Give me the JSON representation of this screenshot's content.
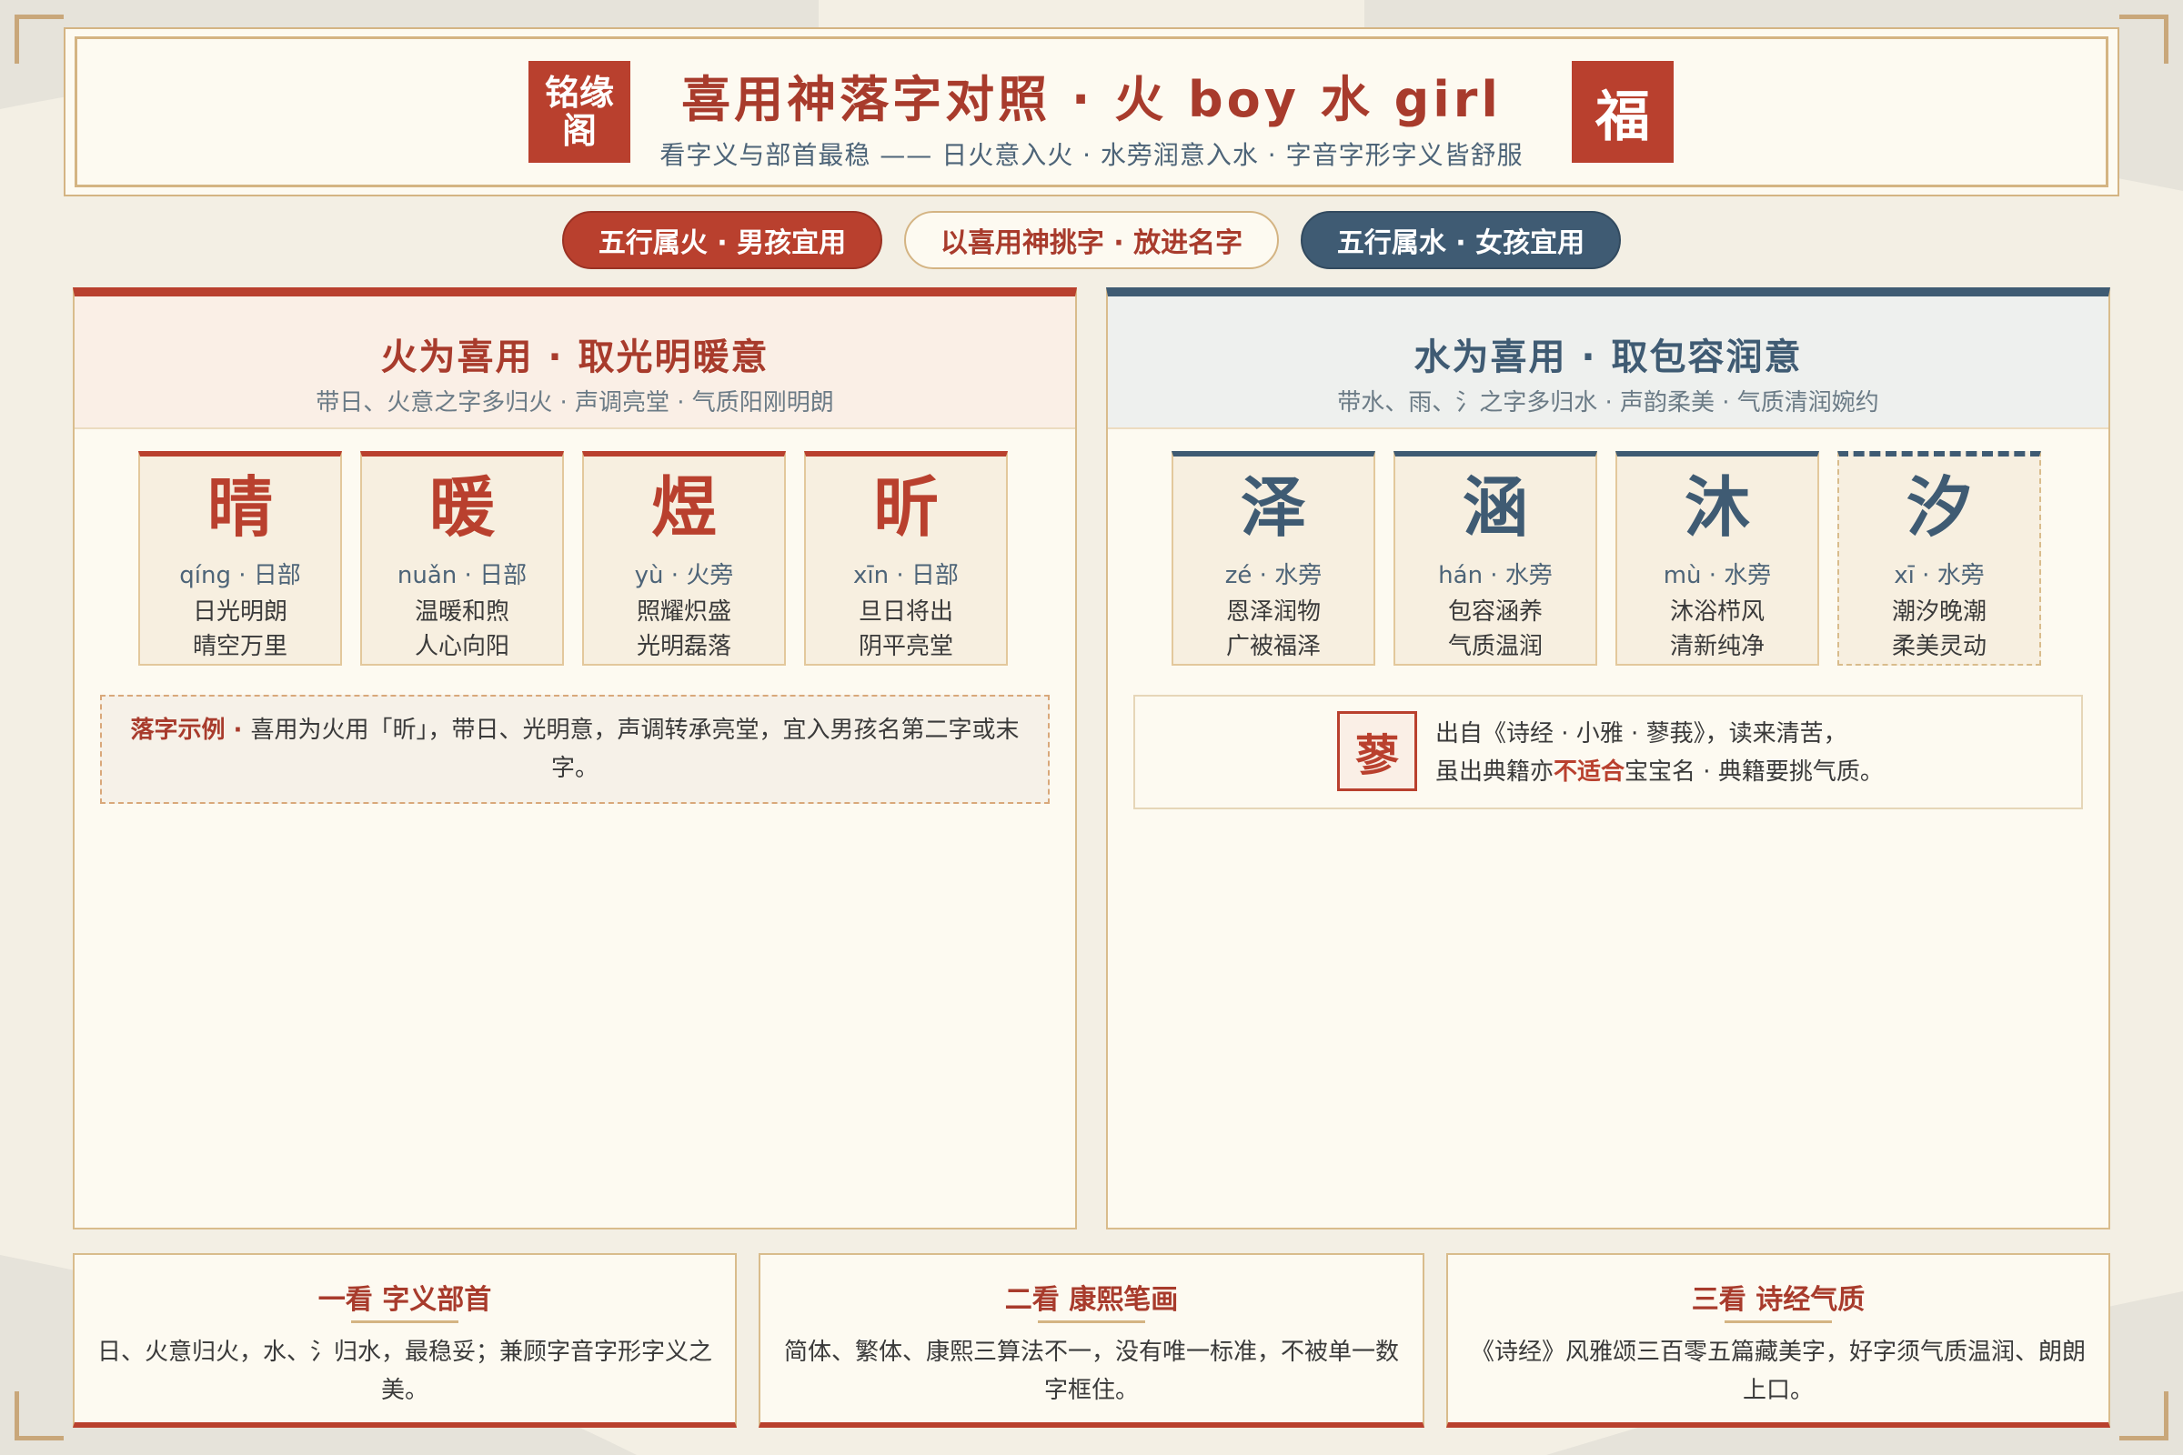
{
  "header": {
    "seal_left": "铭缘阁",
    "title": "喜用神落字对照 · 火 boy 水 girl",
    "subtitle": "看字义与部首最稳 —— 日火意入火 · 水旁润意入水 · 字音字形字义皆舒服",
    "seal_right": "福"
  },
  "pills": {
    "fire": "五行属火 · 男孩宜用",
    "middle": "以喜用神挑字 · 放进名字",
    "water": "五行属水 · 女孩宜用"
  },
  "fire": {
    "title": "火为喜用 · 取光明暖意",
    "subtitle": "带日、火意之字多归火 · 声调亮堂 · 气质阳刚明朗",
    "cards": [
      {
        "char": "晴",
        "pinyin": "qíng · 日部",
        "line1": "日光明朗",
        "line2": "晴空万里"
      },
      {
        "char": "暖",
        "pinyin": "nuǎn · 日部",
        "line1": "温暖和煦",
        "line2": "人心向阳"
      },
      {
        "char": "煜",
        "pinyin": "yù · 火旁",
        "line1": "照耀炽盛",
        "line2": "光明磊落"
      },
      {
        "char": "昕",
        "pinyin": "xīn · 日部",
        "line1": "旦日将出",
        "line2": "阴平亮堂"
      }
    ],
    "example_label": "落字示例 · ",
    "example_text": "喜用为火用「昕」，带日、光明意，声调转承亮堂，宜入男孩名第二字或末字。"
  },
  "water": {
    "title": "水为喜用 · 取包容润意",
    "subtitle": "带水、雨、氵之字多归水 · 声韵柔美 · 气质清润婉约",
    "cards": [
      {
        "char": "泽",
        "pinyin": "zé · 水旁",
        "line1": "恩泽润物",
        "line2": "广被福泽"
      },
      {
        "char": "涵",
        "pinyin": "hán · 水旁",
        "line1": "包容涵养",
        "line2": "气质温润"
      },
      {
        "char": "沐",
        "pinyin": "mù · 水旁",
        "line1": "沐浴栉风",
        "line2": "清新纯净"
      },
      {
        "char": "汐",
        "pinyin": "xī · 水旁",
        "line1": "潮汐晚潮",
        "line2": "柔美灵动"
      }
    ],
    "note_char": "蓼",
    "note_line1": "出自《诗经 · 小雅 · 蓼莪》，读来清苦，",
    "note_line2_a": "虽出典籍亦",
    "note_line2_warn": "不适合",
    "note_line2_b": "宝宝名 · 典籍要挑气质。"
  },
  "tips": [
    {
      "title": "一看 字义部首",
      "text": "日、火意归火，水、氵归水，最稳妥；兼顾字音字形字义之美。"
    },
    {
      "title": "二看 康熙笔画",
      "text": "简体、繁体、康熙三算法不一，没有唯一标准，不被单一数字框住。"
    },
    {
      "title": "三看 诗经气质",
      "text": "《诗经》风雅颂三百零五篇藏美字，好字须气质温润、朗朗上口。"
    }
  ],
  "colors": {
    "fire": "#b9402e",
    "water": "#3f5b73",
    "gold": "#d4b483",
    "background": "#f3efe4",
    "paper": "#fdfaf1"
  }
}
